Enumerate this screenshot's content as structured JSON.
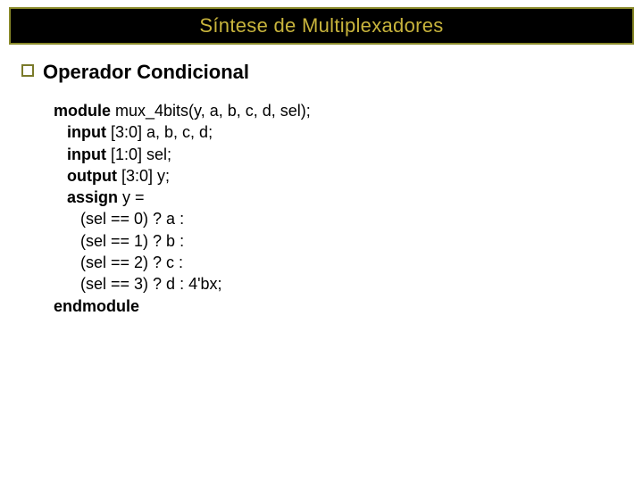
{
  "title": "Síntese de Multiplexadores",
  "heading": "Operador Condicional",
  "code": {
    "kw_module": "module",
    "module_decl": " mux_4bits(y, a, b, c, d, sel);",
    "kw_input1": "input",
    "input1_rest": " [3:0] a, b, c, d;",
    "kw_input2": "input",
    "input2_rest": " [1:0] sel;",
    "kw_output": "output",
    "output_rest": " [3:0] y;",
    "kw_assign": "assign",
    "assign_rest": " y =",
    "line_sel0": "      (sel == 0) ? a :",
    "line_sel1": "      (sel == 1) ? b :",
    "line_sel2": "      (sel == 2) ? c :",
    "line_sel3": "      (sel == 3) ? d : 4'bx;",
    "kw_endmodule": "endmodule"
  }
}
